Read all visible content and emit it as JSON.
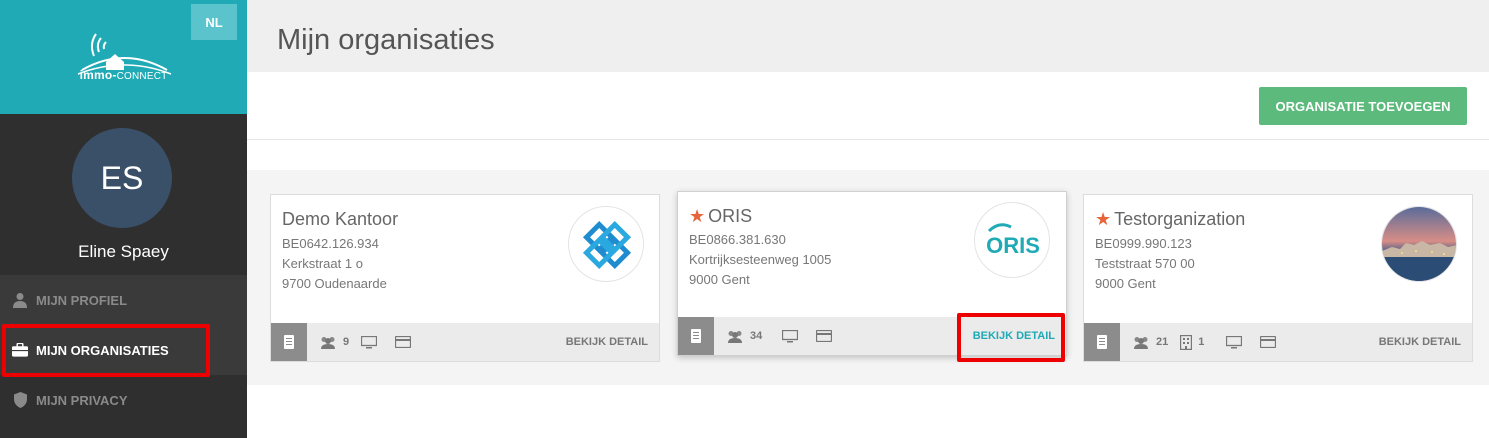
{
  "app": {
    "brand_name": "immo-",
    "brand_sub": "CONNECT",
    "language": "NL"
  },
  "user": {
    "initials": "ES",
    "name": "Eline Spaey"
  },
  "sidebar": {
    "items": [
      {
        "label": "MIJN PROFIEL",
        "icon": "user-icon"
      },
      {
        "label": "MIJN ORGANISATIES",
        "icon": "briefcase-icon",
        "active": true
      },
      {
        "label": "MIJN PRIVACY",
        "icon": "shield-icon"
      }
    ]
  },
  "header": {
    "title": "Mijn organisaties"
  },
  "toolbar": {
    "add_label": "ORGANISATIE TOEVOEGEN"
  },
  "organizations": [
    {
      "name": "Demo Kantoor",
      "favorite": false,
      "vat": "BE0642.126.934",
      "street": "Kerkstraat 1 o",
      "city": "9700 Oudenaarde",
      "users": "9",
      "detail_label": "BEKIJK DETAIL"
    },
    {
      "name": "ORIS",
      "favorite": true,
      "vat": "BE0866.381.630",
      "street": "Kortrijksesteenweg 1005",
      "city": "9000 Gent",
      "users": "34",
      "logo_text": "ORIS",
      "detail_label": "BEKIJK DETAIL"
    },
    {
      "name": "Testorganization",
      "favorite": true,
      "vat": "BE0999.990.123",
      "street": "Teststraat 570 00",
      "city": "9000 Gent",
      "users": "21",
      "buildings": "1",
      "detail_label": "BEKIJK DETAIL"
    }
  ],
  "colors": {
    "brand": "#1faab5",
    "add_button": "#5dba7d",
    "favorite_star": "#e8643a",
    "sidebar_bg": "#2f2f2f"
  }
}
